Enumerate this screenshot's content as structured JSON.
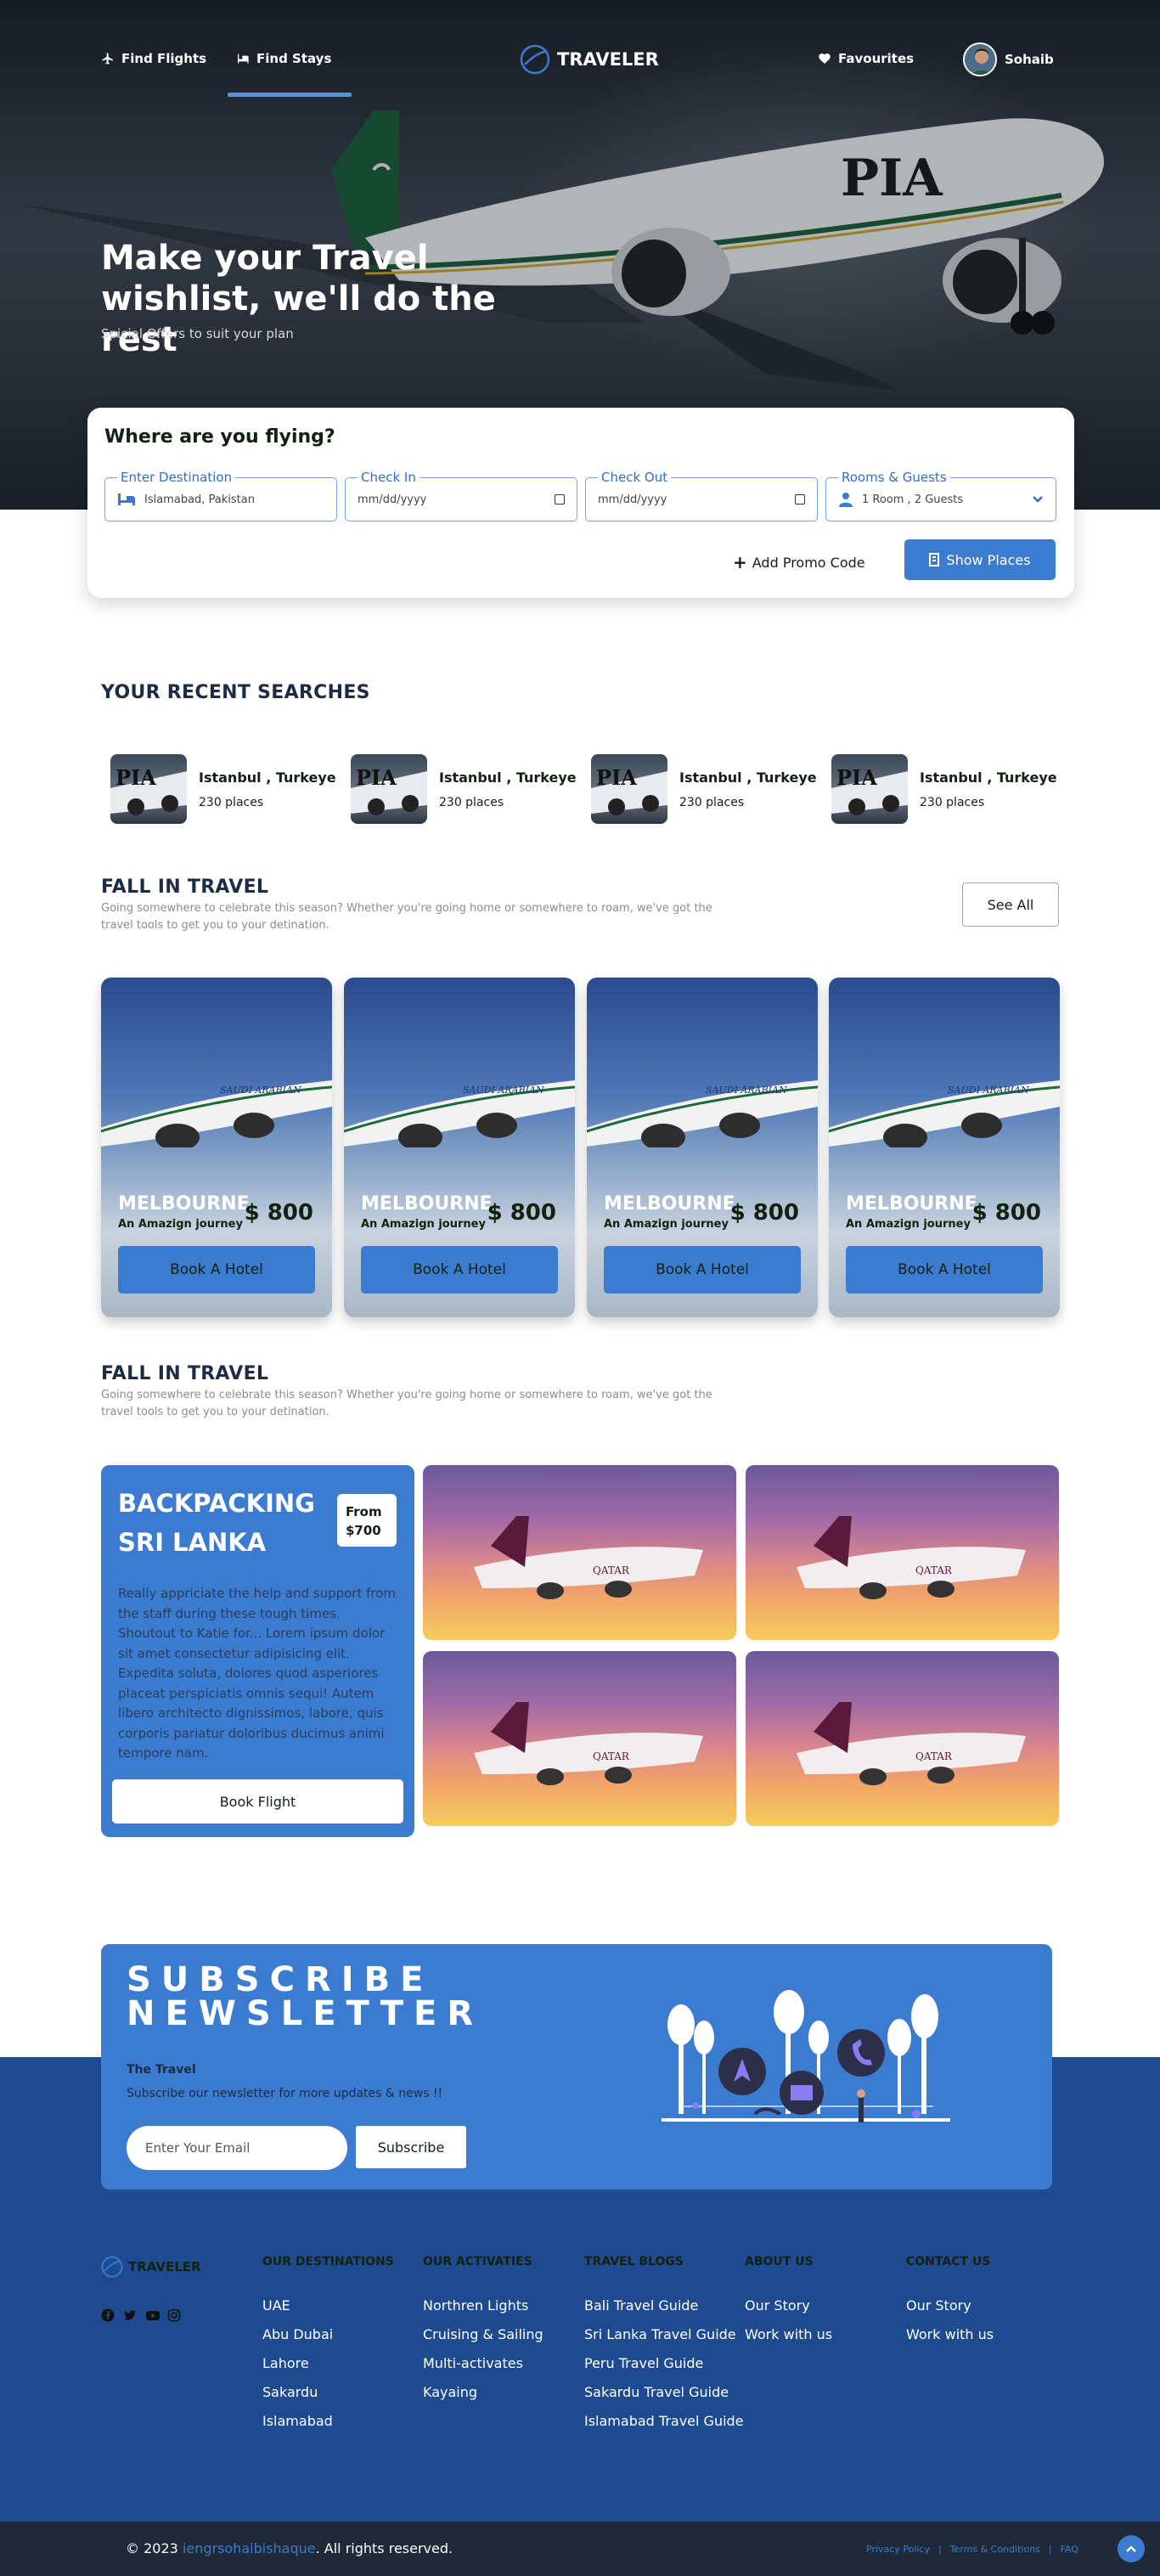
{
  "nav": {
    "find_flights": "Find Flights",
    "find_stays": "Find Stays",
    "brand": "TRAVELER",
    "favourites": "Favourites",
    "user_name": "Sohaib"
  },
  "hero": {
    "title": "Make your Travel wishlist, we'll do the rest",
    "subtitle": "Spicial Offers to suit your plan"
  },
  "search": {
    "title": "Where are you flying?",
    "destination_label": "Enter Destination",
    "destination_value": "Islamabad, Pakistan",
    "checkin_label": "Check In",
    "checkin_value": "mm/dd/yyyy",
    "checkout_label": "Check Out",
    "checkout_value": "mm/dd/yyyy",
    "rooms_label": "Rooms & Guests",
    "rooms_value": "1 Room , 2 Guests",
    "promo": "Add Promo Code",
    "show_places": "Show Places"
  },
  "recent": {
    "heading": "YOUR RECENT SEARCHES",
    "items": [
      {
        "name": "Istanbul , Turkeye",
        "places": "230 places"
      },
      {
        "name": "Istanbul , Turkeye",
        "places": "230 places"
      },
      {
        "name": "Istanbul , Turkeye",
        "places": "230 places"
      },
      {
        "name": "Istanbul , Turkeye",
        "places": "230 places"
      }
    ]
  },
  "fall1": {
    "heading": "FALL IN TRAVEL",
    "description": "Going somewhere to celebrate this season? Whether you're going home or somewhere to roam, we've got the travel tools to get you to your detination.",
    "see_all": "See All",
    "cards": [
      {
        "city": "MELBOURNE",
        "sub": "An Amazign journey",
        "price": "$ 800",
        "button": "Book A Hotel"
      },
      {
        "city": "MELBOURNE",
        "sub": "An Amazign journey",
        "price": "$ 800",
        "button": "Book A Hotel"
      },
      {
        "city": "MELBOURNE",
        "sub": "An Amazign journey",
        "price": "$ 800",
        "button": "Book A Hotel"
      },
      {
        "city": "MELBOURNE",
        "sub": "An Amazign journey",
        "price": "$ 800",
        "button": "Book A Hotel"
      }
    ]
  },
  "fall2": {
    "heading": "FALL IN TRAVEL",
    "description": "Going somewhere to celebrate this season? Whether you're going home or somewhere to roam, we've got the travel tools to get you to your detination."
  },
  "backpacking": {
    "title": "BACKPACKING SRI LANKA",
    "price_from": "From",
    "price_value": "$700",
    "text": "Really appriciate the help and support from the staff during these tough times. Shoutout to Katie for... Lorem ipsum dolor sit amet consectetur adipisicing elit. Expedita soluta, dolores quod asperiores placeat perspiciatis omnis sequi! Autem libero architecto dignissimos, labore, quis corporis pariatur doloribus ducimus animi tempore nam.",
    "button": "Book Flight"
  },
  "newsletter": {
    "title": "SUBSCRIBE NEWSLETTER",
    "brand": "The Travel",
    "subtitle": "Subscribe our newsletter for more updates & news !!",
    "placeholder": "Enter Your Email",
    "button": "Subscribe"
  },
  "footer": {
    "brand": "TRAVELER",
    "columns": [
      {
        "heading": "OUR DESTINATIONS",
        "items": [
          "UAE",
          "Abu Dubai",
          "Lahore",
          "Sakardu",
          "Islamabad"
        ]
      },
      {
        "heading": "OUR ACTIVATIES",
        "items": [
          "Northren Lights",
          "Cruising & Sailing",
          "Multi-activates",
          "Kayaing"
        ]
      },
      {
        "heading": "TRAVEL BLOGS",
        "items": [
          "Bali Travel Guide",
          "Sri Lanka Travel Guide",
          "Peru Travel Guide",
          "Sakardu Travel Guide",
          "Islamabad Travel Guide"
        ]
      },
      {
        "heading": "ABOUT US",
        "items": [
          "Our Story",
          "Work with us"
        ]
      },
      {
        "heading": "CONTACT US",
        "items": [
          "Our Story",
          "Work with us"
        ]
      }
    ],
    "copyright_prefix": "© 2023",
    "copyright_link": "iengrsohaibishaque",
    "copyright_suffix": ". All rights reserved.",
    "privacy": "Privacy Policy",
    "terms": "Terms & Conditions",
    "faq": "FAQ",
    "sep": "|"
  },
  "colors": {
    "accent": "#3b7bd0",
    "footer": "#1e4b8f",
    "bottom_bar": "#1f2937"
  }
}
